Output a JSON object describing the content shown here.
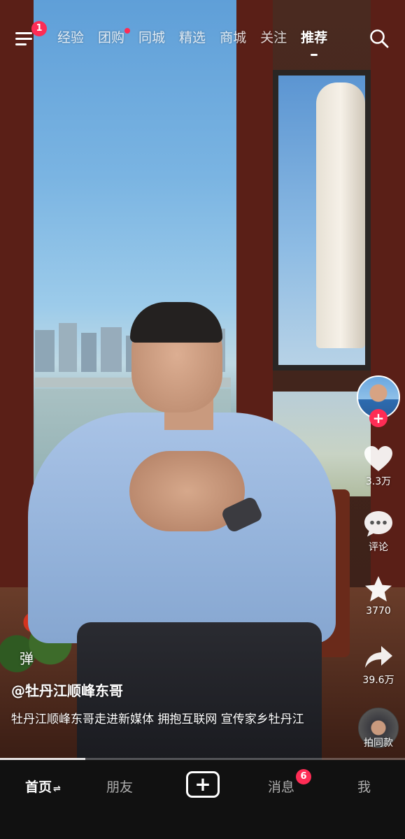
{
  "top_nav": {
    "menu_badge": "1",
    "tabs": [
      {
        "label": "经验"
      },
      {
        "label": "团购"
      },
      {
        "label": "同城"
      },
      {
        "label": "精选"
      },
      {
        "label": "商城"
      },
      {
        "label": "关注"
      },
      {
        "label": "推荐"
      }
    ],
    "active_tab": "推荐",
    "search_icon": "search-icon"
  },
  "actions": {
    "likes": "3.3万",
    "comments": "评论",
    "favorites": "3770",
    "shares": "39.6万",
    "remix": "拍同款"
  },
  "video": {
    "danmu_toggle": "弹",
    "author": "@牡丹江顺峰东哥",
    "caption": "牡丹江顺峰东哥走进新媒体 拥抱互联网 宣传家乡牡丹江",
    "progress": 0.21
  },
  "bottom_nav": {
    "home": "首页",
    "home_suffix": "⇌",
    "friends": "朋友",
    "plus": "+",
    "messages": "消息",
    "messages_badge": "6",
    "me": "我"
  },
  "colors": {
    "accent": "#fe2c55",
    "nav_bg": "#111111"
  }
}
